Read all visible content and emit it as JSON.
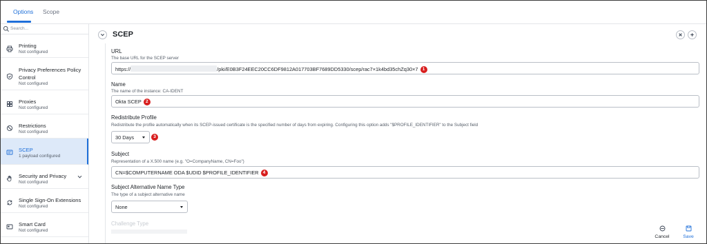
{
  "tabs": [
    {
      "label": "Options",
      "active": true
    },
    {
      "label": "Scope",
      "active": false
    }
  ],
  "sidebar": {
    "search_placeholder": "Search...",
    "items": [
      {
        "label": "Printing",
        "status": "Not configured",
        "icon": "printer-icon"
      },
      {
        "label": "Privacy Preferences Policy Control",
        "status": "Not configured",
        "icon": "shield-check-icon"
      },
      {
        "label": "Proxies",
        "status": "Not configured",
        "icon": "server-icon"
      },
      {
        "label": "Restrictions",
        "status": "Not configured",
        "icon": "prohibited-icon"
      },
      {
        "label": "SCEP",
        "status": "1 payload configured",
        "icon": "certificate-icon",
        "selected": true
      },
      {
        "label": "Security and Privacy",
        "status": "Not configured",
        "icon": "hand-icon",
        "expandable": true
      },
      {
        "label": "Single Sign-On Extensions",
        "status": "Not configured",
        "icon": "sync-icon"
      },
      {
        "label": "Smart Card",
        "status": "Not configured",
        "icon": "card-icon"
      }
    ]
  },
  "main": {
    "title": "SCEP",
    "fields": {
      "url": {
        "label": "URL",
        "description": "The base URL for the SCEP server",
        "value_prefix": "https://",
        "value_suffix": "/pki/E0B3F24EEC20CC6DF9812A017703BF7689DD5330/scep/rac7×1k4bd35chZq30×7",
        "badge": "1"
      },
      "name": {
        "label": "Name",
        "description": "The name of the instance: CA-IDENT",
        "value": "Okta SCEP",
        "badge": "2"
      },
      "redistribute": {
        "label": "Redistribute Profile",
        "description": "Redistribute the profile automatically when its SCEP-issued certificate is the specified number of days from expiring. Configuring this option adds \"$PROFILE_IDENTIFIER\" to the Subject field",
        "value": "30 Days",
        "badge": "3"
      },
      "subject": {
        "label": "Subject",
        "description": "Representation of a X.500 name (e.g. \"O=CompanyName, CN=Foo\")",
        "value": "CN=$COMPUTERNAME ODA $UDID $PROFILE_IDENTIFIER",
        "badge": "4"
      },
      "san_type": {
        "label": "Subject Alternative Name Type",
        "description": "The type of a subject alternative name",
        "value": "None"
      },
      "challenge_type": {
        "label": "Challenge Type"
      }
    },
    "footer": {
      "cancel_label": "Cancel",
      "save_label": "Save"
    }
  },
  "colors": {
    "accent": "#1e6fd9",
    "badge": "#d81e1e",
    "selected_bg": "#dde9f9"
  }
}
